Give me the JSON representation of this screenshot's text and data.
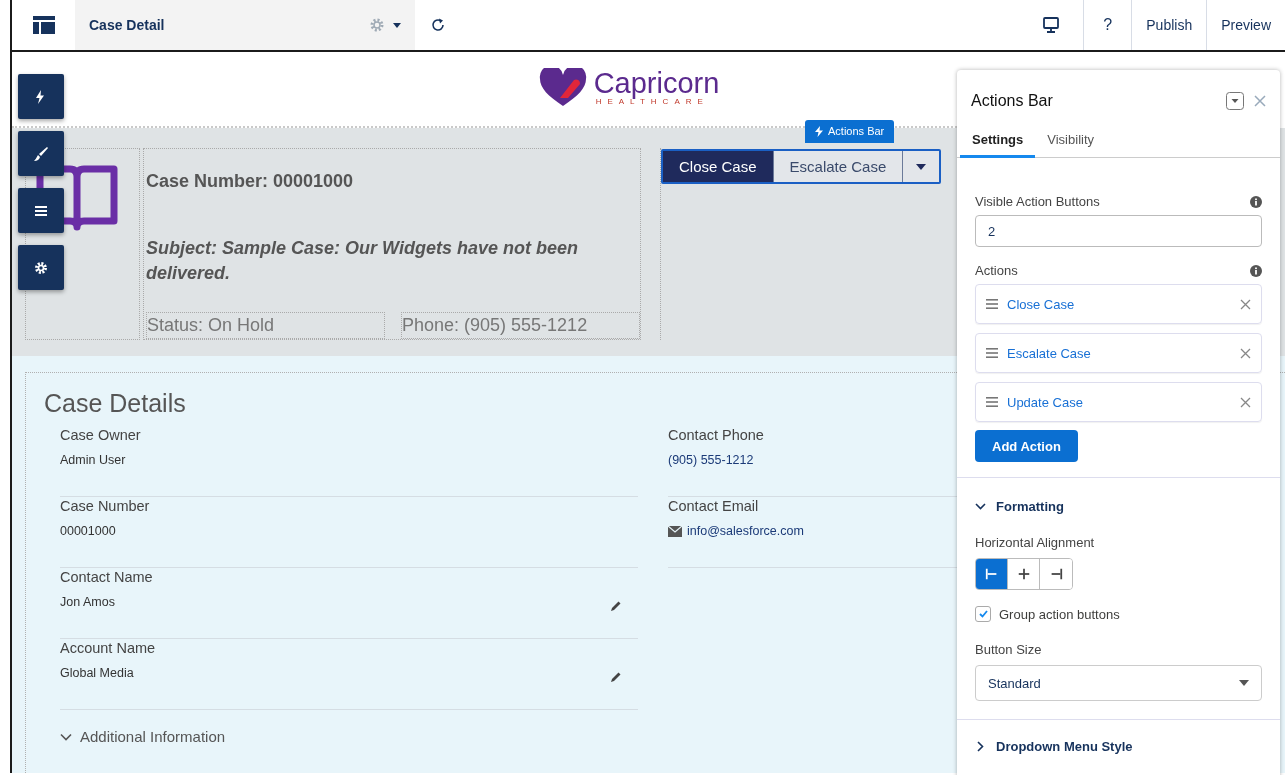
{
  "toolbar": {
    "page_name": "Case Detail",
    "help": "?",
    "buttons": [
      "Publish",
      "Preview"
    ]
  },
  "logo": {
    "name": "Capricorn",
    "tagline": "HEALTHCARE"
  },
  "highlights": {
    "case_number": "Case Number: 00001000",
    "subject": "Subject: Sample Case: Our Widgets have not been delivered.",
    "status": "Status: On Hold",
    "phone": "Phone: (905) 555-1212"
  },
  "actions_bar": {
    "badge": "Actions Bar",
    "buttons": [
      {
        "label": "Close Case",
        "kind": "brand"
      },
      {
        "label": "Escalate Case",
        "kind": "neutral"
      }
    ]
  },
  "case_details": {
    "title": "Case Details",
    "columns": [
      [
        {
          "label": "Case Owner",
          "value": "Admin User",
          "kind": "text",
          "editable": false
        },
        {
          "label": "Case Number",
          "value": "00001000",
          "kind": "text",
          "editable": false
        },
        {
          "label": "Contact Name",
          "value": "Jon Amos",
          "kind": "text",
          "editable": true
        },
        {
          "label": "Account Name",
          "value": "Global Media",
          "kind": "text",
          "editable": true
        }
      ],
      [
        {
          "label": "Contact Phone",
          "value": "(905) 555-1212",
          "kind": "link"
        },
        {
          "label": "Contact Email",
          "value": "info@salesforce.com",
          "kind": "email"
        }
      ]
    ],
    "section": {
      "label": "Additional Information",
      "expanded": true
    }
  },
  "panel": {
    "title": "Actions Bar",
    "tabs": [
      {
        "label": "Settings",
        "selected": true
      },
      {
        "label": "Visibility",
        "selected": false
      }
    ],
    "visible_buttons": {
      "label": "Visible Action Buttons",
      "value": "2"
    },
    "actions": {
      "label": "Actions",
      "items": [
        "Close Case",
        "Escalate Case",
        "Update Case"
      ],
      "add_button": "Add Action"
    },
    "formatting": {
      "label": "Formatting",
      "expanded": true,
      "alignment_label": "Horizontal Alignment",
      "alignments": [
        {
          "kind": "left",
          "selected": true
        },
        {
          "kind": "center",
          "selected": false
        },
        {
          "kind": "right",
          "selected": false
        }
      ],
      "group_checkbox": {
        "label": "Group action buttons",
        "checked": true
      },
      "size_label": "Button Size",
      "size_value": "Standard"
    },
    "dropdown_section": {
      "label": "Dropdown Menu Style",
      "expanded": false
    }
  }
}
